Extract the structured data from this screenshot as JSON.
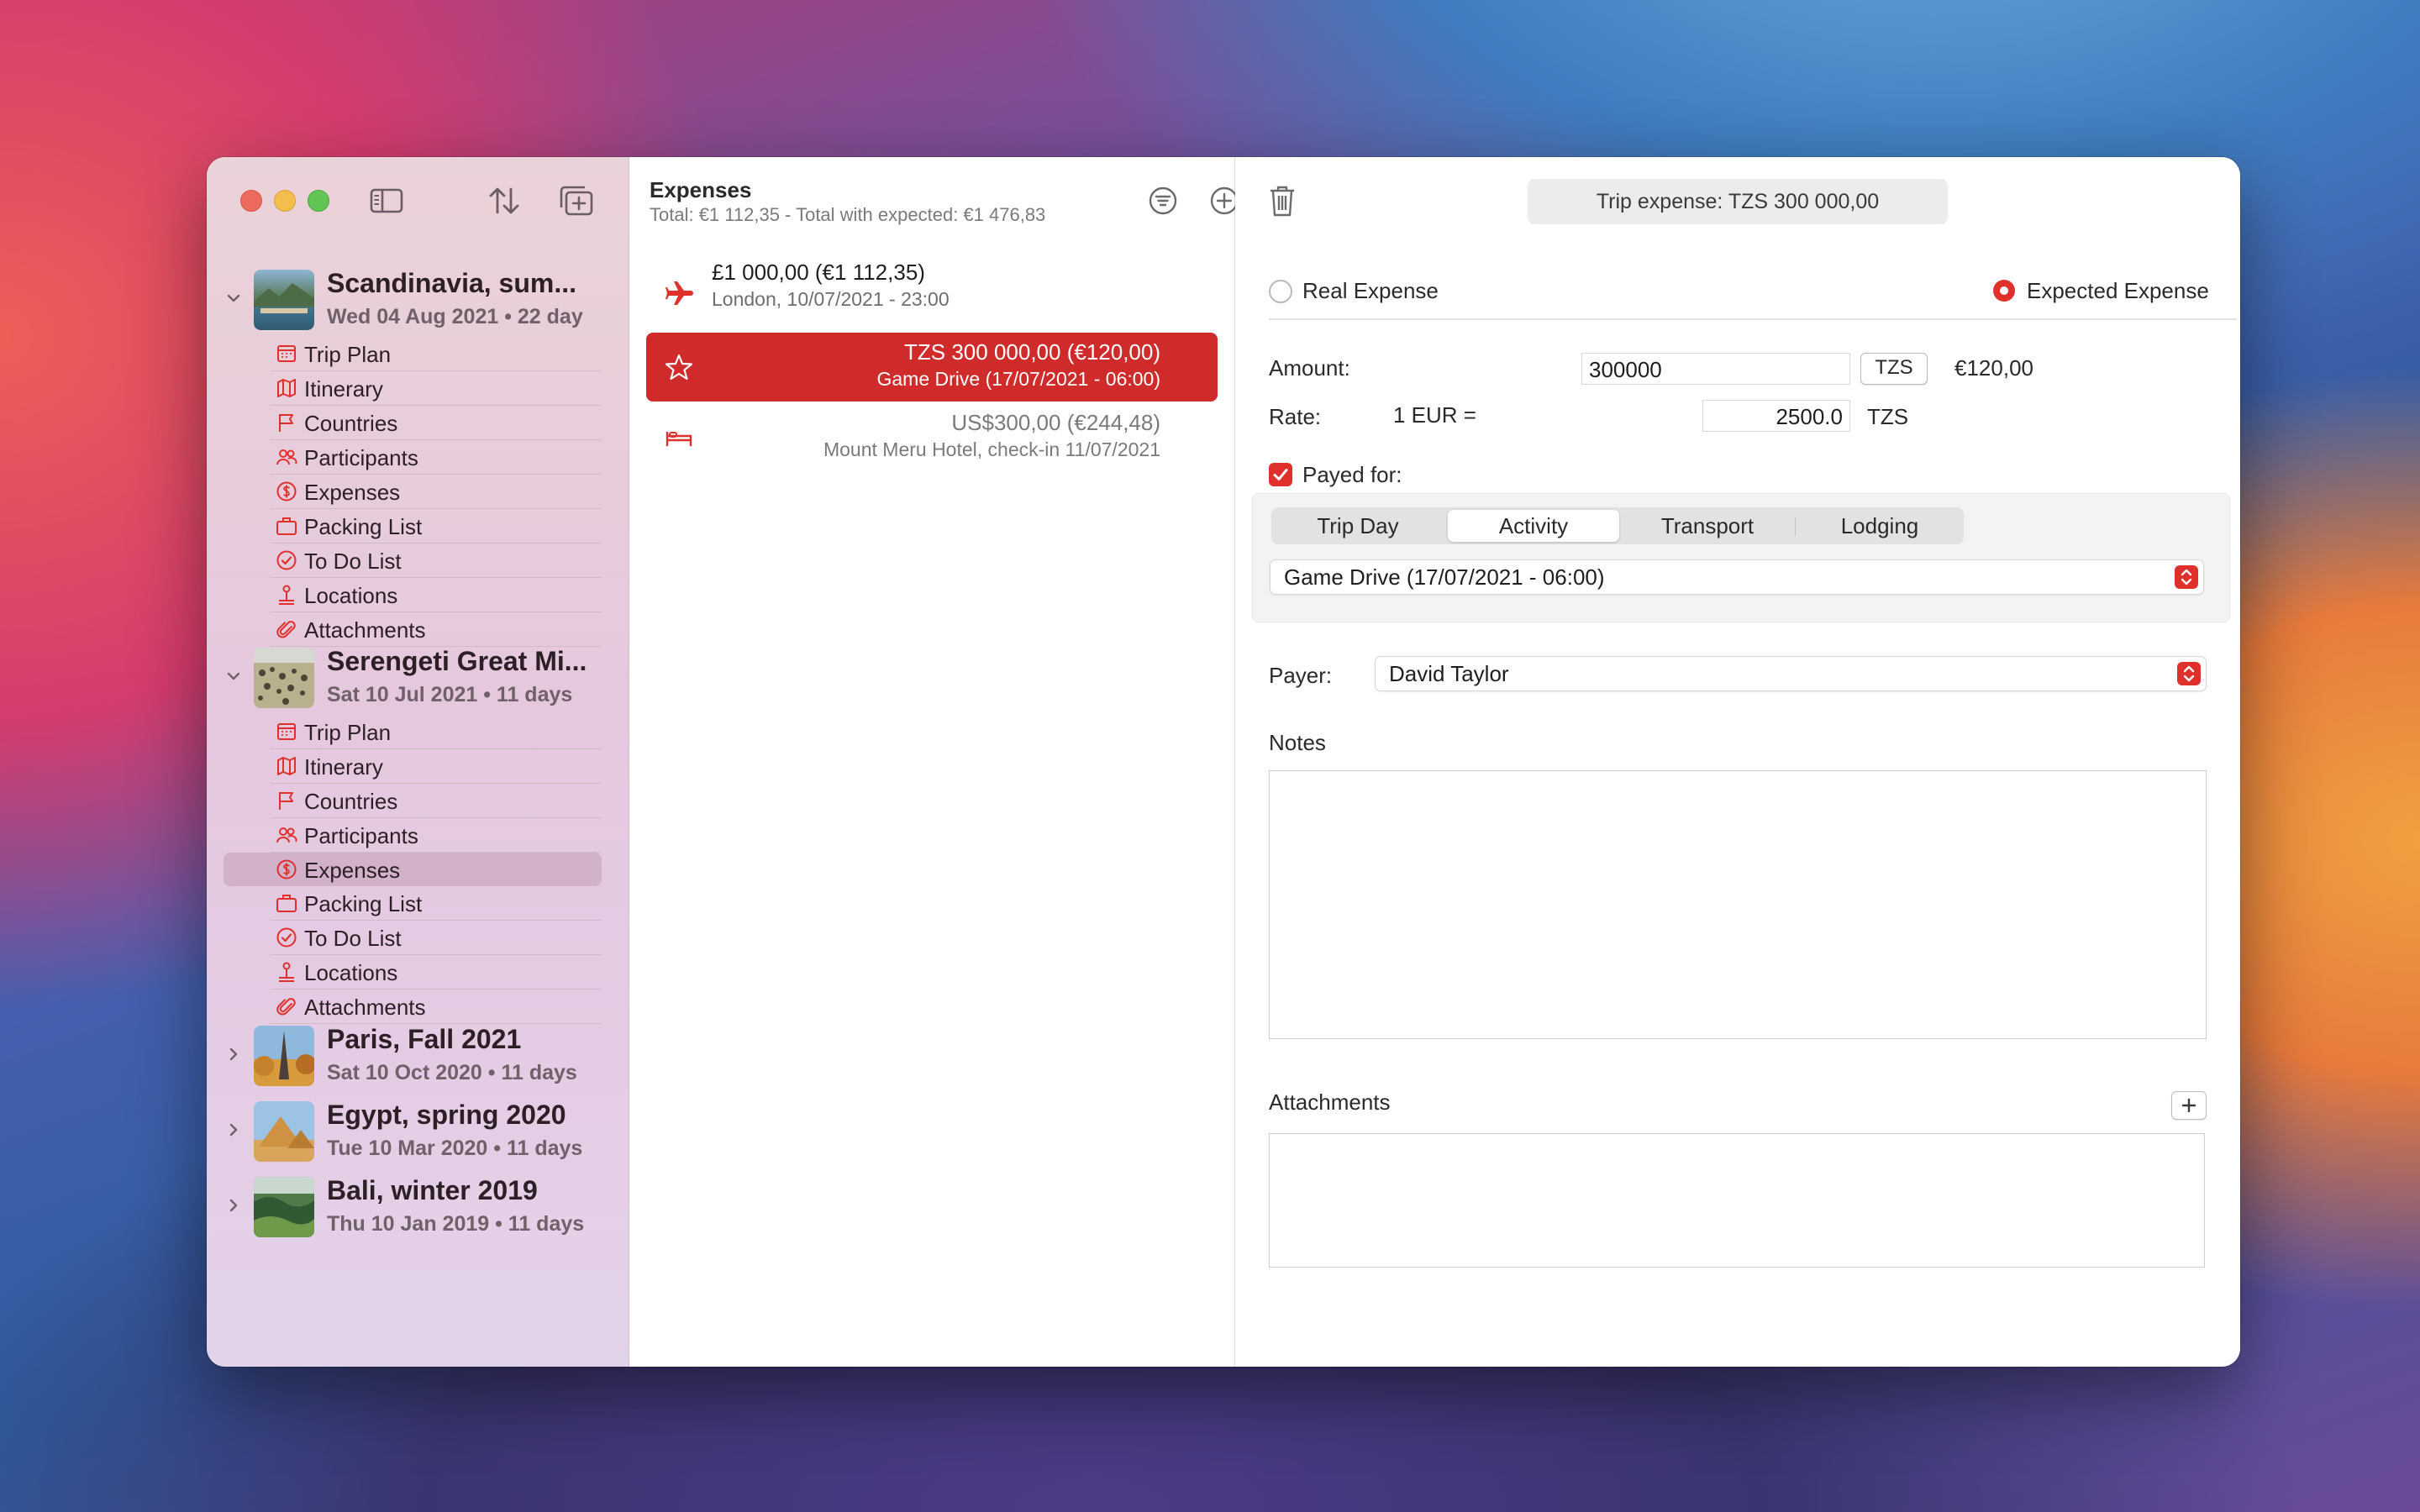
{
  "sidebar": {
    "trips": [
      {
        "name": "Scandinavia, sum...",
        "date": "Wed 04 Aug 2021 •  22 day",
        "expanded": true,
        "items": [
          {
            "label": "Trip Plan",
            "icon": "calendar-icon"
          },
          {
            "label": "Itinerary",
            "icon": "map-icon"
          },
          {
            "label": "Countries",
            "icon": "flag-icon"
          },
          {
            "label": "Participants",
            "icon": "people-icon"
          },
          {
            "label": "Expenses",
            "icon": "dollar-icon"
          },
          {
            "label": "Packing List",
            "icon": "suitcase-icon"
          },
          {
            "label": "To Do List",
            "icon": "checkmark-circle-icon"
          },
          {
            "label": "Locations",
            "icon": "location-pin-icon"
          },
          {
            "label": "Attachments",
            "icon": "paperclip-icon"
          }
        ]
      },
      {
        "name": "Serengeti Great Mi...",
        "date": "Sat 10 Jul 2021 •  11 days",
        "expanded": true,
        "items": [
          {
            "label": "Trip Plan",
            "icon": "calendar-icon"
          },
          {
            "label": "Itinerary",
            "icon": "map-icon"
          },
          {
            "label": "Countries",
            "icon": "flag-icon"
          },
          {
            "label": "Participants",
            "icon": "people-icon"
          },
          {
            "label": "Expenses",
            "icon": "dollar-icon",
            "selected": true
          },
          {
            "label": "Packing List",
            "icon": "suitcase-icon"
          },
          {
            "label": "To Do List",
            "icon": "checkmark-circle-icon"
          },
          {
            "label": "Locations",
            "icon": "location-pin-icon"
          },
          {
            "label": "Attachments",
            "icon": "paperclip-icon"
          }
        ]
      },
      {
        "name": "Paris, Fall 2021",
        "date": "Sat 10 Oct 2020 •  11 days",
        "expanded": false
      },
      {
        "name": "Egypt, spring 2020",
        "date": "Tue 10 Mar 2020 •  11 days",
        "expanded": false
      },
      {
        "name": "Bali, winter 2019",
        "date": "Thu 10 Jan 2019 •  11 days",
        "expanded": false
      }
    ]
  },
  "expenses_list": {
    "title": "Expenses",
    "subtitle": "Total: €1 112,35 - Total with expected: €1 476,83",
    "rows": [
      {
        "icon": "airplane-icon",
        "amount": "£1 000,00  (€1 112,35)",
        "desc": "London, 10/07/2021 - 23:00",
        "selected": false,
        "expected": false
      },
      {
        "icon": "star-icon",
        "amount": "TZS 300 000,00  (€120,00)",
        "desc": "Game Drive (17/07/2021 - 06:00)",
        "selected": true,
        "expected": true
      },
      {
        "icon": "bed-icon",
        "amount": "US$300,00  (€244,48)",
        "desc": "Mount Meru Hotel, check-in 11/07/2021",
        "selected": false,
        "expected": true
      }
    ]
  },
  "detail": {
    "title": "Trip expense: TZS 300 000,00",
    "real_expense_label": "Real Expense",
    "expected_expense_label": "Expected Expense",
    "selected_type": "expected",
    "amount_label": "Amount:",
    "amount_value": "300000",
    "currency": "TZS",
    "converted": "€120,00",
    "rate_label": "Rate:",
    "rate_prefix": "1 EUR =",
    "rate_value": "2500.0",
    "rate_currency": "TZS",
    "payed_for_label": "Payed for:",
    "payed_for_checked": true,
    "segments": [
      "Trip Day",
      "Activity",
      "Transport",
      "Lodging"
    ],
    "active_segment": "Activity",
    "activity_value": "Game Drive (17/07/2021 - 06:00)",
    "payer_label": "Payer:",
    "payer_value": "David Taylor",
    "notes_label": "Notes",
    "attachments_label": "Attachments"
  },
  "colors": {
    "accent": "#e0302c",
    "selection_row": "#d02b2b"
  }
}
